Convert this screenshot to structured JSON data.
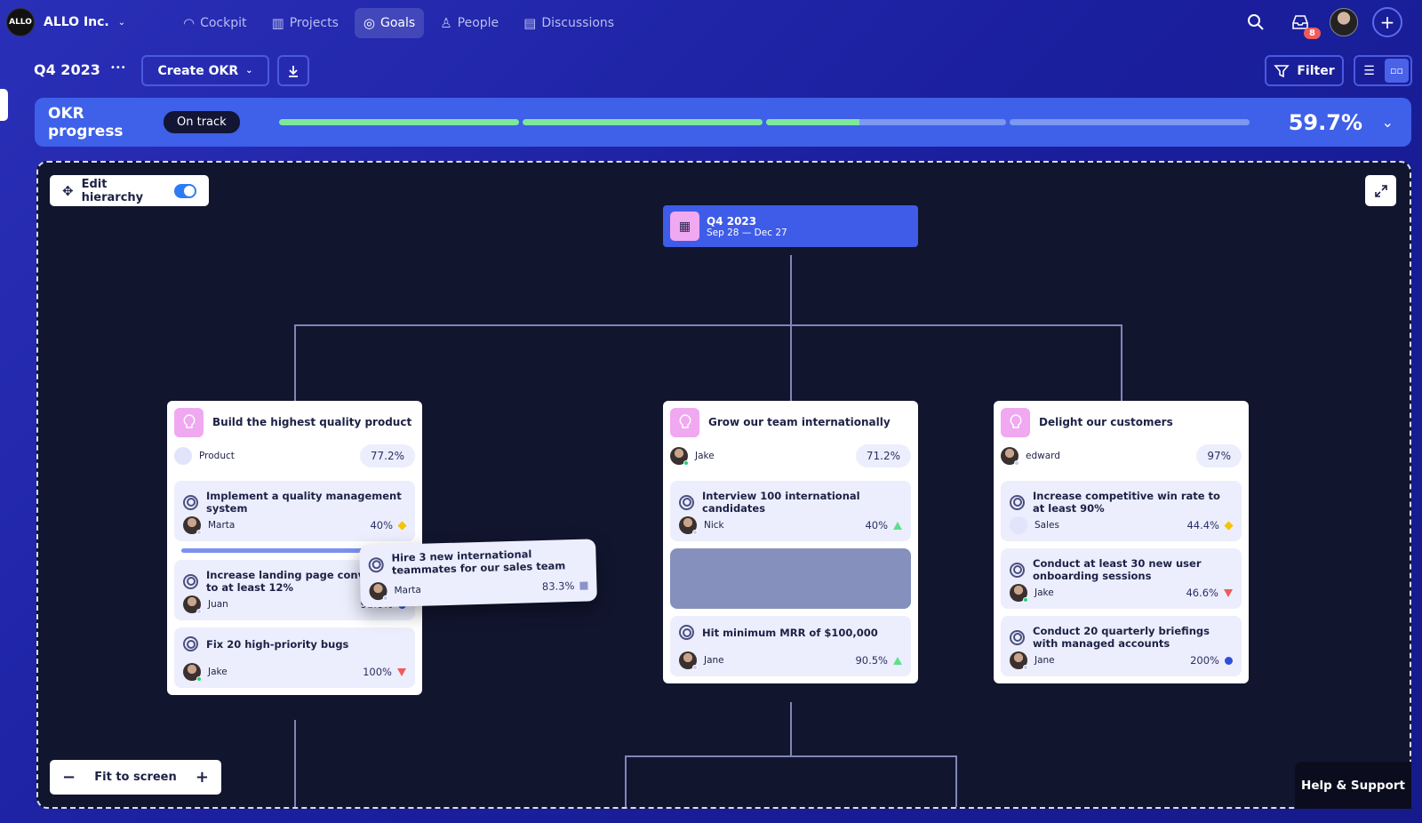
{
  "org": {
    "logo": "ALLO",
    "name": "ALLO Inc."
  },
  "nav": [
    {
      "label": "Cockpit",
      "icon": "gauge-icon"
    },
    {
      "label": "Projects",
      "icon": "board-icon"
    },
    {
      "label": "Goals",
      "icon": "target-icon",
      "active": true
    },
    {
      "label": "People",
      "icon": "person-icon"
    },
    {
      "label": "Discussions",
      "icon": "discussion-icon"
    }
  ],
  "header": {
    "notifications": "8"
  },
  "toolbar": {
    "period": "Q4 2023",
    "more": "•••",
    "create": "Create OKR",
    "filter": "Filter"
  },
  "progress": {
    "label": "OKR progress",
    "status": "On track",
    "value": "59.7%",
    "segments": [
      1,
      1,
      0.39,
      0
    ],
    "fill_color": "#7de89a"
  },
  "canvas": {
    "edit_hierarchy": "Edit hierarchy",
    "edit_hierarchy_on": true,
    "fit": "Fit to screen",
    "help": "Help & Support"
  },
  "root": {
    "title": "Q4 2023",
    "dates": "Sep 28 — Dec 27"
  },
  "objectives": [
    {
      "title": "Build the highest quality product",
      "owner": "Product",
      "team": true,
      "pct": "77.2%",
      "krs": [
        {
          "title": "Implement a quality management system",
          "owner": "Marta",
          "pct": "40%",
          "status": "diamond-yellow"
        },
        {
          "title": "Increase landing page conversion to at least 12%",
          "owner": "Juan",
          "pct": "91.6%",
          "status": "circle-blue"
        },
        {
          "title": "Fix 20 high-priority bugs",
          "owner": "Jake",
          "pct": "100%",
          "status": "triangle-down-red",
          "online": true
        }
      ]
    },
    {
      "title": "Grow our team internationally",
      "owner": "Jake",
      "online": true,
      "pct": "71.2%",
      "krs": [
        {
          "title": "Interview 100 international candidates",
          "owner": "Nick",
          "pct": "40%",
          "status": "triangle-up-green"
        },
        {
          "placeholder": true
        },
        {
          "title": "Hit minimum MRR of $100,000",
          "owner": "Jane",
          "pct": "90.5%",
          "status": "triangle-up-green"
        }
      ]
    },
    {
      "title": "Delight our customers",
      "owner": "edward",
      "pct": "97%",
      "krs": [
        {
          "title": "Increase competitive win rate to at least 90%",
          "owner": "Sales",
          "team": true,
          "pct": "44.4%",
          "status": "diamond-yellow"
        },
        {
          "title": "Conduct at least 30 new user onboarding sessions",
          "owner": "Jake",
          "online": true,
          "pct": "46.6%",
          "status": "triangle-down-red"
        },
        {
          "title": "Conduct 20 quarterly briefings with managed accounts",
          "owner": "Jane",
          "pct": "200%",
          "status": "circle-blue"
        }
      ]
    }
  ],
  "dragged": {
    "title": "Hire 3 new international teammates for our sales team",
    "owner": "Marta",
    "pct": "83.3%",
    "status": "square-gray"
  }
}
